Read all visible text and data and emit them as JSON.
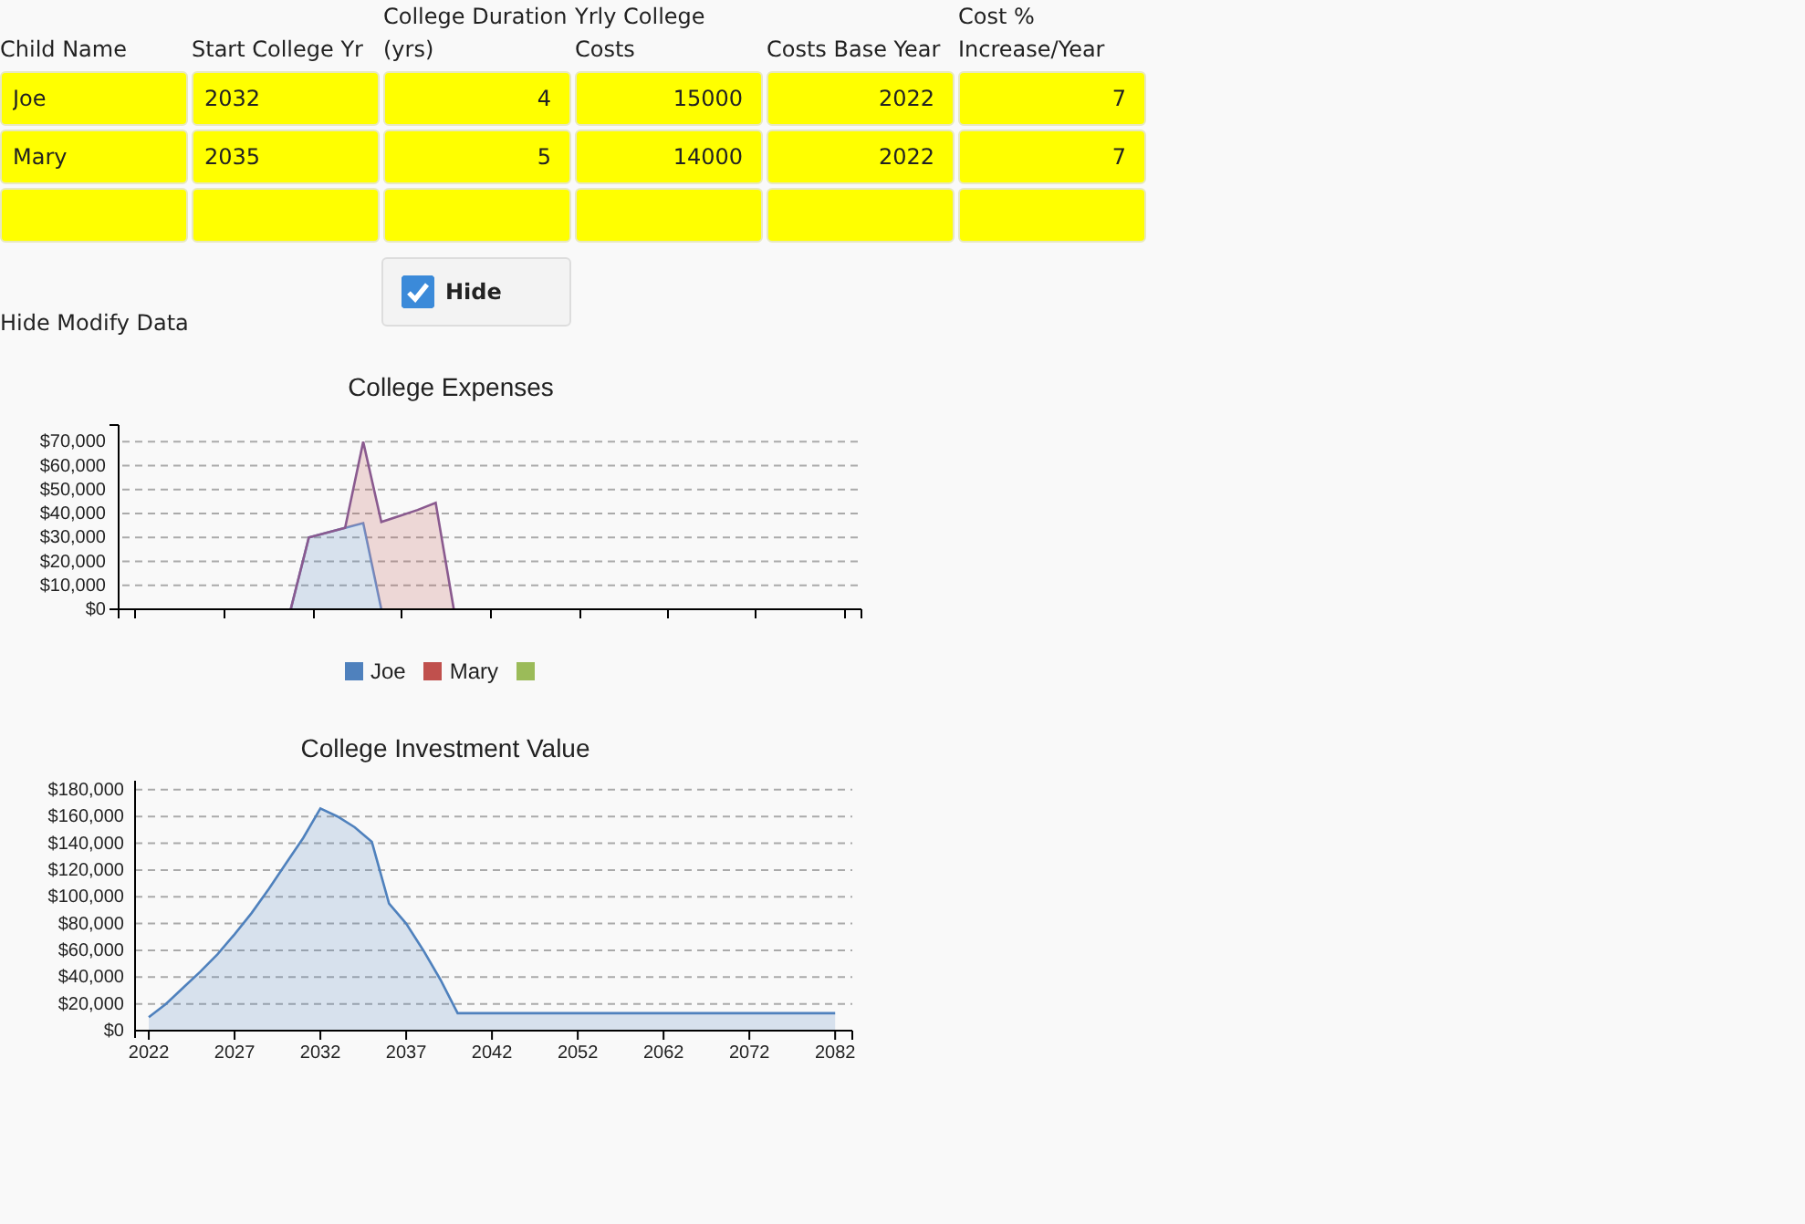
{
  "table": {
    "columns": [
      "Child Name",
      "Start College Yr",
      "College Duration (yrs)",
      "Yrly College Costs",
      "Costs Base Year",
      "Cost % Increase/Year"
    ],
    "rows": [
      [
        "Joe",
        "2032",
        "4",
        "15000",
        "2022",
        "7"
      ],
      [
        "Mary",
        "2035",
        "5",
        "14000",
        "2022",
        "7"
      ],
      [
        "",
        "",
        "",
        "",
        "",
        ""
      ]
    ]
  },
  "hide_toggle": {
    "label": "Hide",
    "checked": true
  },
  "hide_label": "Hide Modify Data",
  "expenses_chart": {
    "chart_data": {
      "type": "area",
      "title": "College Expenses",
      "stacked": true,
      "grid": true,
      "categories": [
        null,
        null,
        null,
        null,
        null,
        null,
        null,
        null,
        null,
        null,
        null,
        null,
        null,
        null,
        null,
        null,
        null,
        null,
        null,
        null,
        null,
        null,
        null,
        null,
        null,
        null,
        null,
        null,
        null,
        null,
        null,
        null,
        null,
        null,
        null,
        null,
        null,
        null,
        null,
        null,
        null
      ],
      "series": [
        {
          "name": "Joe",
          "color": "#4f81bd",
          "values": [
            null,
            null,
            null,
            null,
            null,
            null,
            null,
            null,
            null,
            0,
            30000,
            32000,
            34000,
            36000,
            0,
            null,
            null,
            null,
            null,
            null,
            null,
            null,
            null,
            null,
            null,
            null,
            null,
            null,
            null,
            null,
            null,
            null,
            null,
            null,
            null,
            null,
            null,
            null,
            null,
            null,
            null
          ]
        },
        {
          "name": "Mary",
          "color": "#c0504d",
          "values": [
            null,
            null,
            null,
            null,
            null,
            null,
            null,
            null,
            null,
            0,
            0,
            0,
            0,
            34000,
            36500,
            39000,
            41500,
            44500,
            0,
            null,
            null,
            null,
            null,
            null,
            null,
            null,
            null,
            null,
            null,
            null,
            null,
            null,
            null,
            null,
            null,
            null,
            null,
            null,
            null,
            null,
            null
          ]
        }
      ],
      "ylim": [
        0,
        77000
      ],
      "yticks": [
        {
          "value": 0,
          "label": "$0"
        },
        {
          "value": 10000,
          "label": "$10,000"
        },
        {
          "value": 20000,
          "label": "$20,000"
        },
        {
          "value": 30000,
          "label": "$30,000"
        },
        {
          "value": 40000,
          "label": "$40,000"
        },
        {
          "value": 50000,
          "label": "$50,000"
        },
        {
          "value": 60000,
          "label": "$60,000"
        },
        {
          "value": 70000,
          "label": "$70,000"
        }
      ]
    },
    "extra_legend_swatch": {
      "color": "#9bbb59"
    }
  },
  "investment_chart": {
    "chart_data": {
      "type": "area",
      "title": "College Investment Value",
      "grid": true,
      "categories": [
        "2022",
        null,
        null,
        null,
        null,
        "2027",
        null,
        null,
        null,
        null,
        "2032",
        null,
        null,
        null,
        null,
        "2037",
        null,
        null,
        null,
        null,
        "2042",
        null,
        null,
        null,
        null,
        "2052",
        null,
        null,
        null,
        null,
        "2062",
        null,
        null,
        null,
        null,
        "2072",
        null,
        null,
        null,
        null,
        "2082"
      ],
      "series": [
        {
          "color": "#4f81bd",
          "values": [
            10000,
            20000,
            32000,
            44000,
            57000,
            72000,
            88000,
            106000,
            125000,
            144000,
            166000,
            160000,
            152000,
            141000,
            95000,
            80000,
            60000,
            38000,
            13000,
            13000,
            13000,
            13000,
            13000,
            13000,
            13000,
            13000,
            13000,
            13000,
            13000,
            13000,
            13000,
            13000,
            13000,
            13000,
            13000,
            13000,
            13000,
            13000,
            13000,
            13000,
            13000
          ]
        }
      ],
      "ylim": [
        0,
        184000
      ],
      "yticks": [
        {
          "value": 0,
          "label": "$0"
        },
        {
          "value": 20000,
          "label": "$20,000"
        },
        {
          "value": 40000,
          "label": "$40,000"
        },
        {
          "value": 60000,
          "label": "$60,000"
        },
        {
          "value": 80000,
          "label": "$80,000"
        },
        {
          "value": 100000,
          "label": "$100,000"
        },
        {
          "value": 120000,
          "label": "$120,000"
        },
        {
          "value": 140000,
          "label": "$140,000"
        },
        {
          "value": 160000,
          "label": "$160,000"
        },
        {
          "value": 180000,
          "label": "$180,000"
        }
      ]
    }
  }
}
